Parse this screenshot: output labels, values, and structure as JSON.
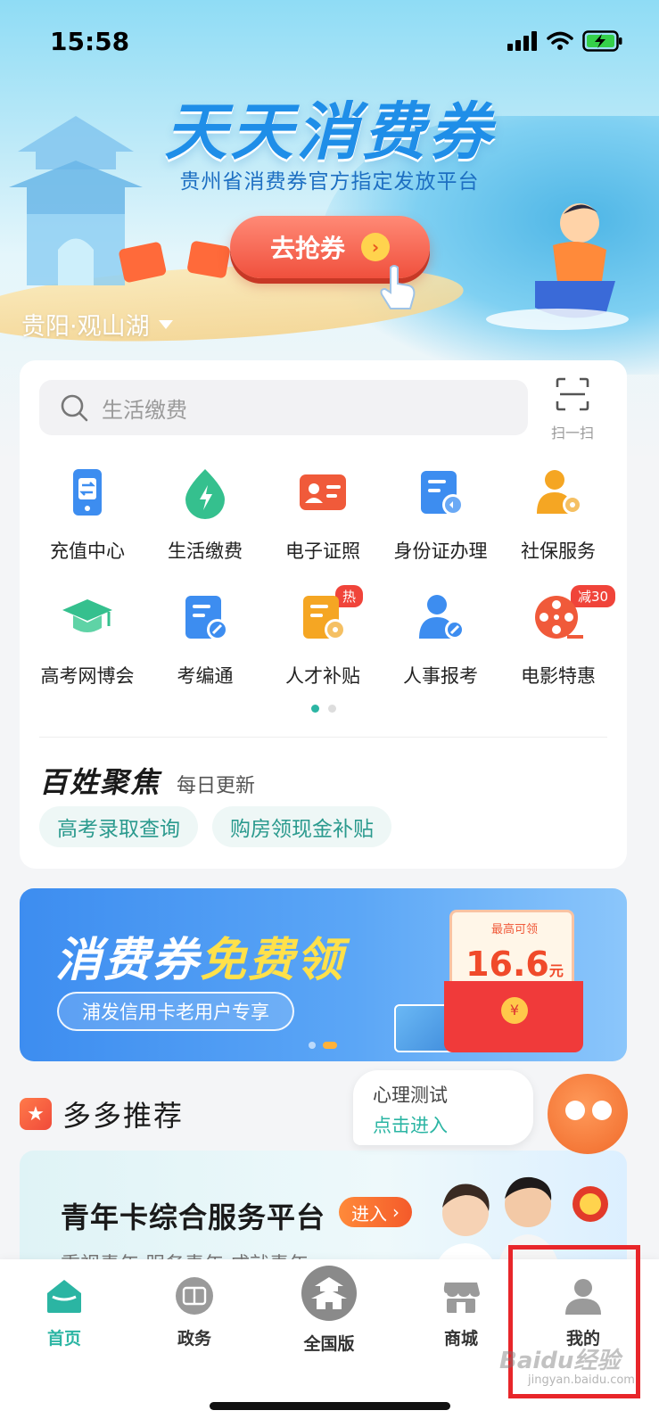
{
  "status_bar": {
    "time": "15:58"
  },
  "hero": {
    "title": "天天消费券",
    "subtitle": "贵州省消费券官方指定发放平台",
    "button": "去抢券",
    "location": "贵阳·观山湖"
  },
  "search": {
    "placeholder": "生活缴费",
    "scan_label": "扫一扫"
  },
  "services": [
    {
      "label": "充值中心",
      "icon": "recharge-icon",
      "color": "#3d8df0"
    },
    {
      "label": "生活缴费",
      "icon": "utility-drop-icon",
      "color": "#35c08e"
    },
    {
      "label": "电子证照",
      "icon": "id-card-icon",
      "color": "#f05a3a"
    },
    {
      "label": "身份证办理",
      "icon": "id-document-icon",
      "color": "#3d8df0"
    },
    {
      "label": "社保服务",
      "icon": "social-security-icon",
      "color": "#f5a623"
    },
    {
      "label": "高考网博会",
      "icon": "graduation-cap-icon",
      "color": "#35c08e"
    },
    {
      "label": "考编通",
      "icon": "exam-document-icon",
      "color": "#3d8df0"
    },
    {
      "label": "人才补贴",
      "icon": "talent-subsidy-icon",
      "color": "#f5a623",
      "badge": "热"
    },
    {
      "label": "人事报考",
      "icon": "personnel-exam-icon",
      "color": "#3d8df0"
    },
    {
      "label": "电影特惠",
      "icon": "film-reel-icon",
      "color": "#f05a3a",
      "badge": "减30"
    }
  ],
  "focus": {
    "title": "百姓聚焦",
    "subtitle": "每日更新",
    "chips": [
      "高考录取查询",
      "购房领现金补贴"
    ]
  },
  "coupon_banner": {
    "title_a": "消费券",
    "title_b": "免费领",
    "pill": "浦发信用卡老用户专享",
    "envelope_top": "最高可领",
    "amount": "16.6",
    "unit": "元",
    "seal": "¥"
  },
  "recommend": {
    "title": "多多推荐",
    "psy_line1": "心理测试",
    "psy_line2": "点击进入",
    "youth_title": "青年卡综合服务平台",
    "youth_enter": "进入",
    "youth_sub": "重视青年·服务青年·成就青年"
  },
  "tabs": [
    {
      "label": "首页",
      "icon": "home-icon"
    },
    {
      "label": "政务",
      "icon": "government-seal-icon"
    },
    {
      "label": "全国版",
      "icon": "pagoda-icon"
    },
    {
      "label": "商城",
      "icon": "store-icon"
    },
    {
      "label": "我的",
      "icon": "user-icon"
    }
  ],
  "watermark": {
    "main": "Baidu经验",
    "sub": "jingyan.baidu.com"
  },
  "colors": {
    "accent": "#2bb5a3",
    "highlight": "#e8262a",
    "hero_title": "#1f8ee8",
    "cta": "#f0503d"
  }
}
